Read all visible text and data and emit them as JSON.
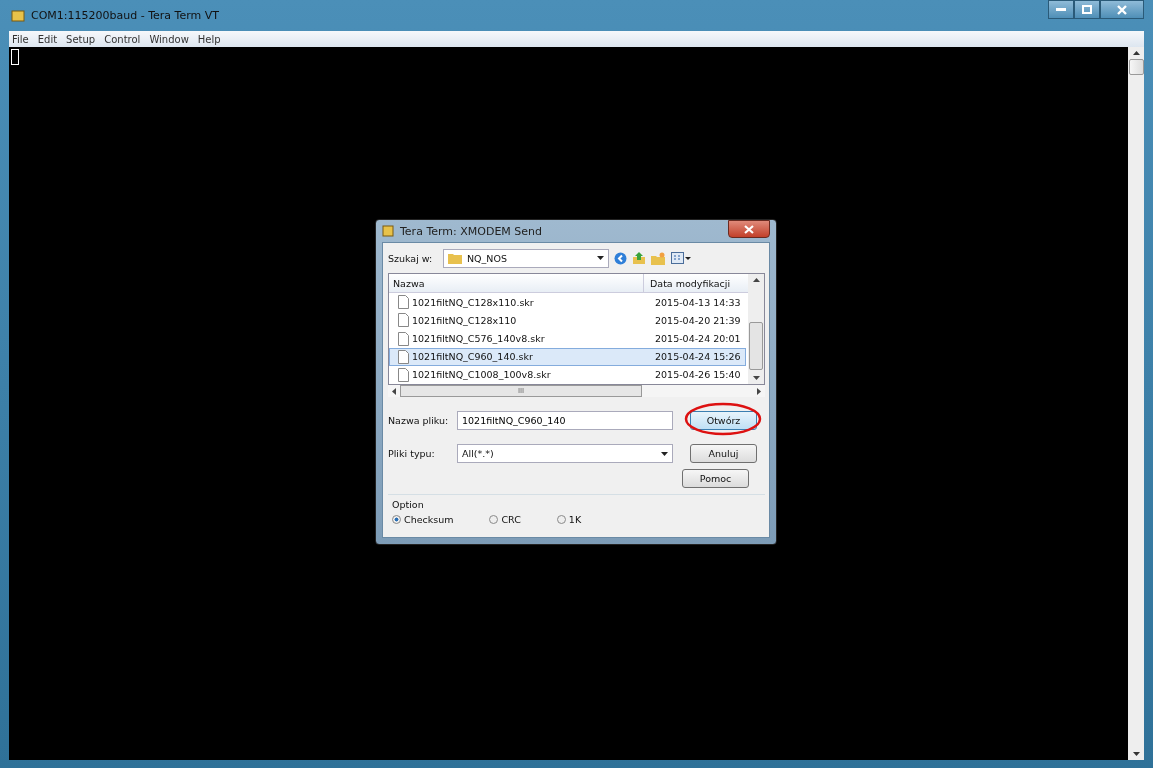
{
  "window": {
    "title": "COM1:115200baud - Tera Term VT"
  },
  "menu": [
    "File",
    "Edit",
    "Setup",
    "Control",
    "Window",
    "Help"
  ],
  "dialog": {
    "title": "Tera Term: XMODEM Send",
    "look_in": {
      "label": "Szukaj w:",
      "value": "NQ_NOS"
    },
    "columns": [
      "Nazwa",
      "Data modyfikacji"
    ],
    "files": [
      {
        "name": "1021filtNQ_C128x110.skr",
        "date": "2015-04-13 14:33",
        "selected": false
      },
      {
        "name": "1021filtNQ_C128x110",
        "date": "2015-04-20 21:39",
        "selected": false
      },
      {
        "name": "1021filtNQ_C576_140v8.skr",
        "date": "2015-04-24 20:01",
        "selected": false
      },
      {
        "name": "1021filtNQ_C960_140.skr",
        "date": "2015-04-24 15:26",
        "selected": true
      },
      {
        "name": "1021filtNQ_C1008_100v8.skr",
        "date": "2015-04-26 15:40",
        "selected": false
      }
    ],
    "hscroll_label": "III",
    "filename": {
      "label": "Nazwa pliku:",
      "value": "1021filtNQ_C960_140"
    },
    "filetype": {
      "label": "Pliki typu:",
      "value": "All(*.*)"
    },
    "buttons": [
      "Otwórz",
      "Anuluj",
      "Pomoc"
    ],
    "option": {
      "label": "Option",
      "choices": [
        {
          "label": "Checksum",
          "selected": true
        },
        {
          "label": "CRC",
          "selected": false
        },
        {
          "label": "1K",
          "selected": false
        }
      ]
    }
  }
}
